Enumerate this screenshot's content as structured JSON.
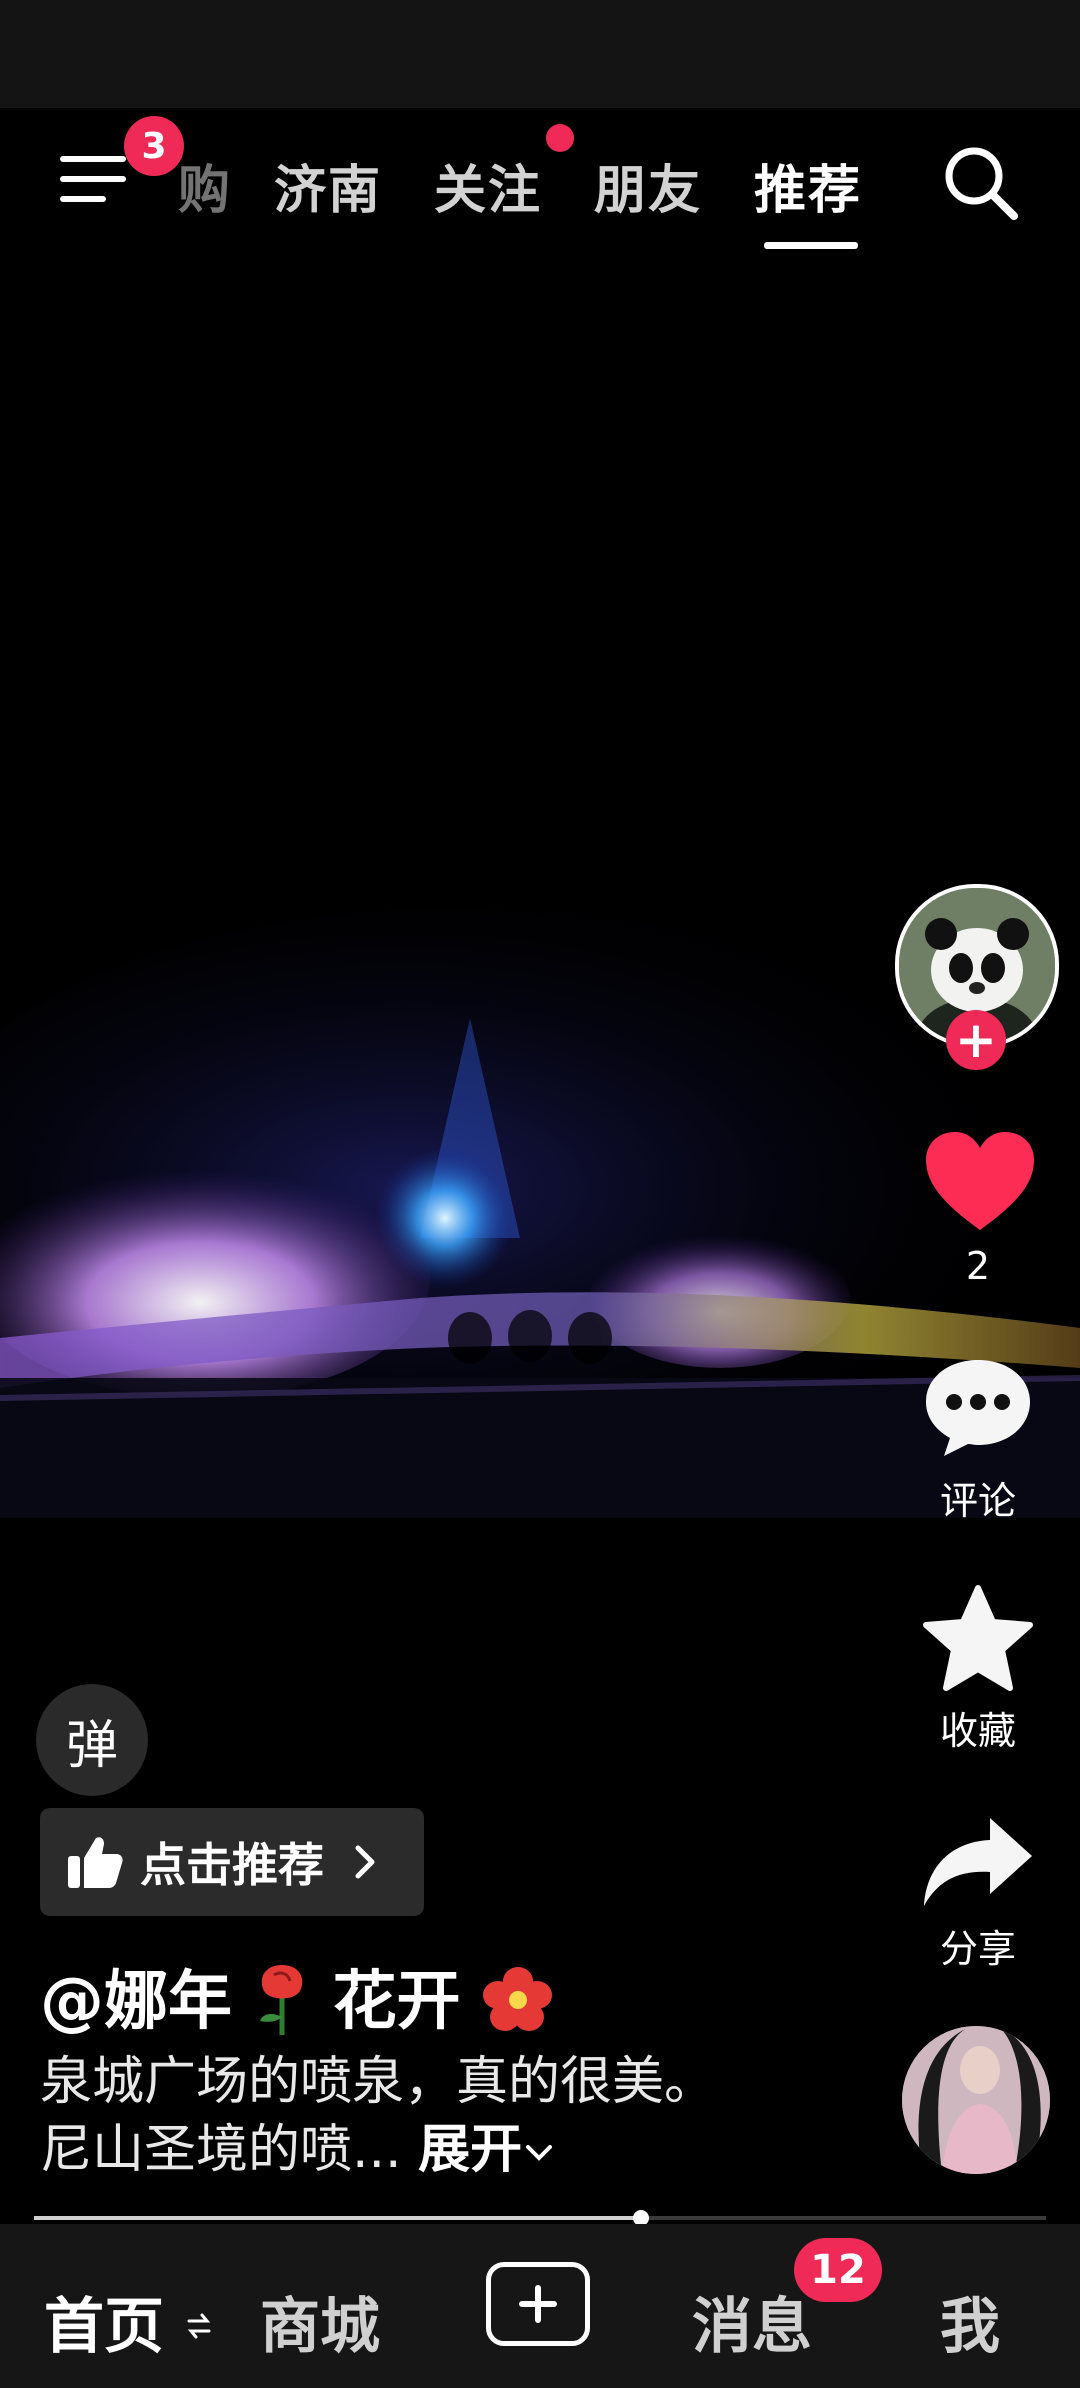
{
  "top_nav": {
    "menu_badge": "3",
    "tabs": [
      "购",
      "济南",
      "关注",
      "朋友",
      "推荐"
    ]
  },
  "video": {
    "like_count": "2",
    "comment_label": "评论",
    "favorite_label": "收藏",
    "share_label": "分享",
    "danmu_label": "弹",
    "recommend_label": "点击推荐",
    "author_prefix": "@娜年",
    "author_suffix": "花开",
    "description": "泉城广场的喷泉，真的很美。尼山圣境的喷...",
    "expand_label": "展开",
    "progress": 0.6
  },
  "bottom_nav": {
    "home": "首页",
    "mall": "商城",
    "messages": "消息",
    "messages_badge": "12",
    "me": "我"
  },
  "colors": {
    "accent": "#f02a57",
    "background": "#000000"
  }
}
